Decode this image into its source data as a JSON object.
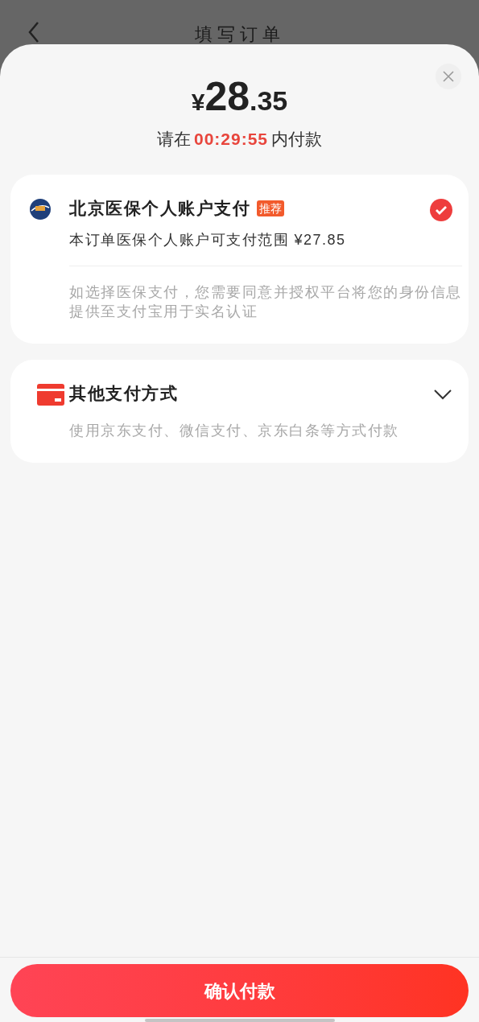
{
  "background_page": {
    "title": "填写订单"
  },
  "sheet": {
    "price": {
      "currency": "¥",
      "integer": "28",
      "decimal": ".35"
    },
    "countdown": {
      "prefix": "请在",
      "time": "00:29:55",
      "suffix": "内付款"
    },
    "methods": [
      {
        "kind": "insurance",
        "title": "北京医保个人账户支付",
        "badge": "推荐",
        "detail": "本订单医保个人账户可支付范围 ¥27.85",
        "note": "如选择医保支付，您需要同意并授权平台将您的身份信息提供至支付宝用于实名认证",
        "selected": true
      },
      {
        "kind": "other",
        "title": "其他支付方式",
        "note": "使用京东支付、微信支付、京东白条等方式付款",
        "expanded": false
      }
    ],
    "confirm_button": "确认付款"
  }
}
